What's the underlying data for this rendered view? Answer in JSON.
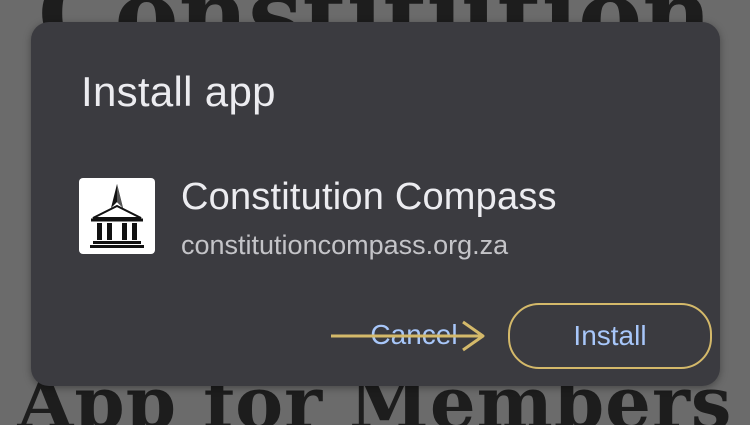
{
  "background": {
    "heading_top": "Constitution",
    "heading_bottom": "App for Members"
  },
  "dialog": {
    "title": "Install app",
    "app": {
      "name": "Constitution Compass",
      "url": "constitutioncompass.org.za",
      "icon": "courthouse-compass-icon"
    },
    "buttons": {
      "cancel_label": "Cancel",
      "install_label": "Install"
    }
  },
  "annotation": {
    "arrow_icon": "right-arrow-icon",
    "highlight_color": "#d4b96a",
    "target": "Install"
  },
  "colors": {
    "dialog_bg": "#3b3b40",
    "accent_text": "#a8c7fa",
    "scrim": "#6b6b6b"
  }
}
